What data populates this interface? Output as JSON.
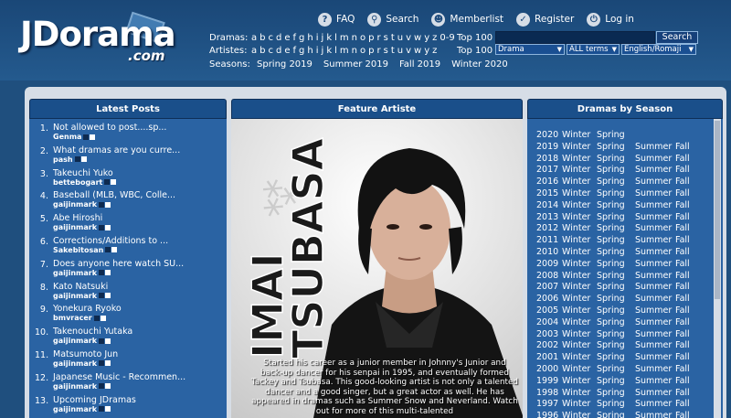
{
  "logo": {
    "main": "JDorama",
    "tld": ".com"
  },
  "topnav": [
    {
      "label": "FAQ",
      "icon": "question-icon",
      "glyph": "?"
    },
    {
      "label": "Search",
      "icon": "search-icon",
      "glyph": "⚲"
    },
    {
      "label": "Memberlist",
      "icon": "members-icon",
      "glyph": "☻"
    },
    {
      "label": "Register",
      "icon": "register-icon",
      "glyph": "✓"
    },
    {
      "label": "Log in",
      "icon": "power-icon",
      "glyph": "⏻"
    }
  ],
  "dramas_row": {
    "label": "Dramas:",
    "top100": "Top 100",
    "letters": [
      "a",
      "b",
      "c",
      "d",
      "e",
      "f",
      "g",
      "h",
      "i",
      "j",
      "k",
      "l",
      "m",
      "n",
      "o",
      "p",
      "r",
      "s",
      "t",
      "u",
      "v",
      "w",
      "y",
      "z",
      "0-9"
    ]
  },
  "artistes_row": {
    "label": "Artistes:",
    "top100": "Top 100",
    "letters": [
      "a",
      "b",
      "c",
      "d",
      "e",
      "f",
      "g",
      "h",
      "i",
      "j",
      "k",
      "l",
      "m",
      "n",
      "o",
      "p",
      "r",
      "s",
      "t",
      "u",
      "v",
      "w",
      "y",
      "z"
    ]
  },
  "seasons_row": {
    "label": "Seasons:",
    "items": [
      "Spring 2019",
      "Summer 2019",
      "Fall 2019",
      "Winter 2020"
    ]
  },
  "search": {
    "button": "Search",
    "selects": [
      "Drama",
      "ALL terms",
      "English/Romaji"
    ]
  },
  "panels": {
    "latest": "Latest Posts",
    "feature": "Feature Artiste",
    "season": "Dramas by Season"
  },
  "posts": [
    {
      "n": "1.",
      "title": "Not allowed to post....sp...",
      "user": "Genma"
    },
    {
      "n": "2.",
      "title": "What dramas are you curre...",
      "user": "pash"
    },
    {
      "n": "3.",
      "title": "Takeuchi Yuko",
      "user": "bettebogart"
    },
    {
      "n": "4.",
      "title": "Baseball (MLB, WBC, Colle...",
      "user": "gaijinmark"
    },
    {
      "n": "5.",
      "title": "Abe Hiroshi",
      "user": "gaijinmark"
    },
    {
      "n": "6.",
      "title": "Corrections/Additions to ...",
      "user": "Sakebitosan"
    },
    {
      "n": "7.",
      "title": "Does anyone here watch SU...",
      "user": "gaijinmark"
    },
    {
      "n": "8.",
      "title": "Kato Natsuki",
      "user": "gaijinmark"
    },
    {
      "n": "9.",
      "title": "Yonekura Ryoko",
      "user": "bmvracer"
    },
    {
      "n": "10.",
      "title": "Takenouchi Yutaka",
      "user": "gaijinmark"
    },
    {
      "n": "11.",
      "title": "Matsumoto Jun",
      "user": "gaijinmark"
    },
    {
      "n": "12.",
      "title": "Japanese Music - Recommen...",
      "user": "gaijinmark"
    },
    {
      "n": "13.",
      "title": "Upcoming JDramas",
      "user": "gaijinmark"
    }
  ],
  "feature": {
    "name_lines": [
      "IMAI",
      "TSUBASA"
    ],
    "caption": "Started his career as a junior member in Johnny's Junior and back-up dancer for his senpai in 1995, and eventually formed Tackey and Tsubasa. This good-looking artist is not only a talented dancer and a good singer, but a great actor as well. He has appeared in dramas such as Summer Snow and Neverland. Watch out for more of this multi-talented"
  },
  "seasons": [
    {
      "year": "2020",
      "s": [
        "Winter",
        "Spring"
      ]
    },
    {
      "year": "2019",
      "s": [
        "Winter",
        "Spring",
        "Summer",
        "Fall"
      ]
    },
    {
      "year": "2018",
      "s": [
        "Winter",
        "Spring",
        "Summer",
        "Fall"
      ]
    },
    {
      "year": "2017",
      "s": [
        "Winter",
        "Spring",
        "Summer",
        "Fall"
      ]
    },
    {
      "year": "2016",
      "s": [
        "Winter",
        "Spring",
        "Summer",
        "Fall"
      ]
    },
    {
      "year": "2015",
      "s": [
        "Winter",
        "Spring",
        "Summer",
        "Fall"
      ]
    },
    {
      "year": "2014",
      "s": [
        "Winter",
        "Spring",
        "Summer",
        "Fall"
      ]
    },
    {
      "year": "2013",
      "s": [
        "Winter",
        "Spring",
        "Summer",
        "Fall"
      ]
    },
    {
      "year": "2012",
      "s": [
        "Winter",
        "Spring",
        "Summer",
        "Fall"
      ]
    },
    {
      "year": "2011",
      "s": [
        "Winter",
        "Spring",
        "Summer",
        "Fall"
      ]
    },
    {
      "year": "2010",
      "s": [
        "Winter",
        "Spring",
        "Summer",
        "Fall"
      ]
    },
    {
      "year": "2009",
      "s": [
        "Winter",
        "Spring",
        "Summer",
        "Fall"
      ]
    },
    {
      "year": "2008",
      "s": [
        "Winter",
        "Spring",
        "Summer",
        "Fall"
      ]
    },
    {
      "year": "2007",
      "s": [
        "Winter",
        "Spring",
        "Summer",
        "Fall"
      ]
    },
    {
      "year": "2006",
      "s": [
        "Winter",
        "Spring",
        "Summer",
        "Fall"
      ]
    },
    {
      "year": "2005",
      "s": [
        "Winter",
        "Spring",
        "Summer",
        "Fall"
      ]
    },
    {
      "year": "2004",
      "s": [
        "Winter",
        "Spring",
        "Summer",
        "Fall"
      ]
    },
    {
      "year": "2003",
      "s": [
        "Winter",
        "Spring",
        "Summer",
        "Fall"
      ]
    },
    {
      "year": "2002",
      "s": [
        "Winter",
        "Spring",
        "Summer",
        "Fall"
      ]
    },
    {
      "year": "2001",
      "s": [
        "Winter",
        "Spring",
        "Summer",
        "Fall"
      ]
    },
    {
      "year": "2000",
      "s": [
        "Winter",
        "Spring",
        "Summer",
        "Fall"
      ]
    },
    {
      "year": "1999",
      "s": [
        "Winter",
        "Spring",
        "Summer",
        "Fall"
      ]
    },
    {
      "year": "1998",
      "s": [
        "Winter",
        "Spring",
        "Summer",
        "Fall"
      ]
    },
    {
      "year": "1997",
      "s": [
        "Winter",
        "Spring",
        "Summer",
        "Fall"
      ]
    },
    {
      "year": "1996",
      "s": [
        "Winter",
        "Spring",
        "Summer",
        "Fall"
      ]
    }
  ],
  "colors": {
    "accent": "#2a63a3",
    "header": "#1f4f7e",
    "panel_frame": "#d6dde6"
  }
}
